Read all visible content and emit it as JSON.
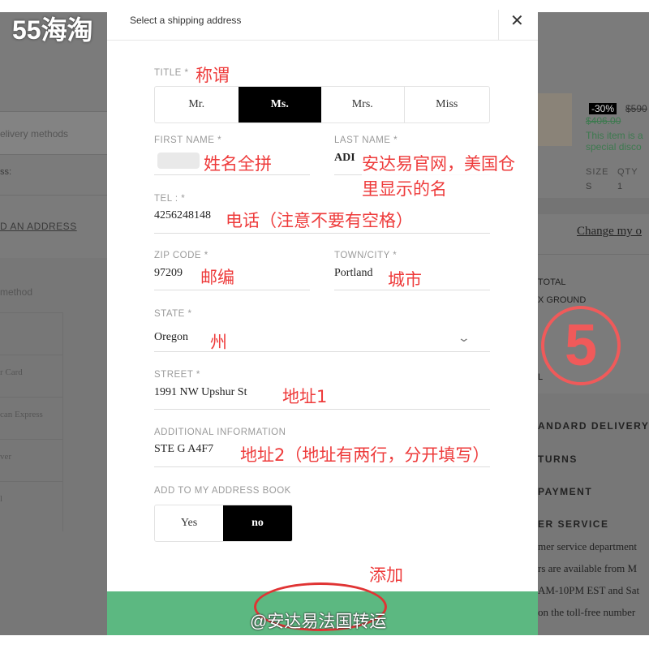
{
  "watermark_top": "55海淘",
  "watermark_bottom": "@安达易法国转运",
  "background": {
    "left": {
      "delivery_methods": "elivery methods",
      "address_label": "ss:",
      "add_address_link": "D AN ADDRESS",
      "payment_method": "method",
      "cards": [
        "r Card",
        "can Express",
        "ver",
        "l"
      ]
    },
    "right": {
      "discount_badge": "-30%",
      "original_price": "$590",
      "sale_price": "$406.00",
      "promo_line1": "This item is a",
      "promo_line2": "special disco",
      "size_label": "SIZE",
      "qty_label": "QTY",
      "size_value": "S",
      "qty_value": "1",
      "change_link": "Change my o",
      "total": "TOTAL",
      "shipping": "X GROUND",
      "total2": "L",
      "standard_delivery": "ANDARD DELIVERY",
      "returns": "TURNS",
      "payment": "PAYMENT",
      "customer_service": "ER SERVICE",
      "service_lines": [
        "mer service department",
        "rs are available from M",
        "AM-10PM EST and Sat",
        "on the toll-free number"
      ]
    }
  },
  "modal": {
    "title": "Select a shipping address",
    "close_icon": "close-icon",
    "title_label": "TITLE *",
    "title_options": [
      "Mr.",
      "Ms.",
      "Mrs.",
      "Miss"
    ],
    "title_selected": "Ms.",
    "first_name_label": "FIRST NAME *",
    "first_name_value": "",
    "last_name_label": "LAST NAME *",
    "last_name_value": "ADI",
    "tel_label": "TEL : *",
    "tel_value": "4256248148",
    "zip_label": "ZIP CODE *",
    "zip_value": "97209",
    "city_label": "TOWN/CITY *",
    "city_value": "Portland",
    "state_label": "STATE *",
    "state_value": "Oregon",
    "street_label": "STREET *",
    "street_value": "1991 NW Upshur St",
    "additional_label": "ADDITIONAL INFORMATION",
    "additional_value": "STE G A4F7",
    "address_book_label": "ADD TO MY ADDRESS BOOK",
    "address_book_options": [
      "Yes",
      "no"
    ],
    "address_book_selected": "no",
    "submit_color": "#5cb881"
  },
  "annotations": {
    "title": "称谓",
    "first_name": "姓名全拼",
    "last_name_1": "安达易官网，美国仓",
    "last_name_2": "里显示的名",
    "tel": "电话（注意不要有空格）",
    "zip": "邮编",
    "city": "城市",
    "state": "州",
    "street": "地址1",
    "additional": "地址2（地址有两行，分开填写）",
    "add": "添加",
    "step": "5"
  }
}
